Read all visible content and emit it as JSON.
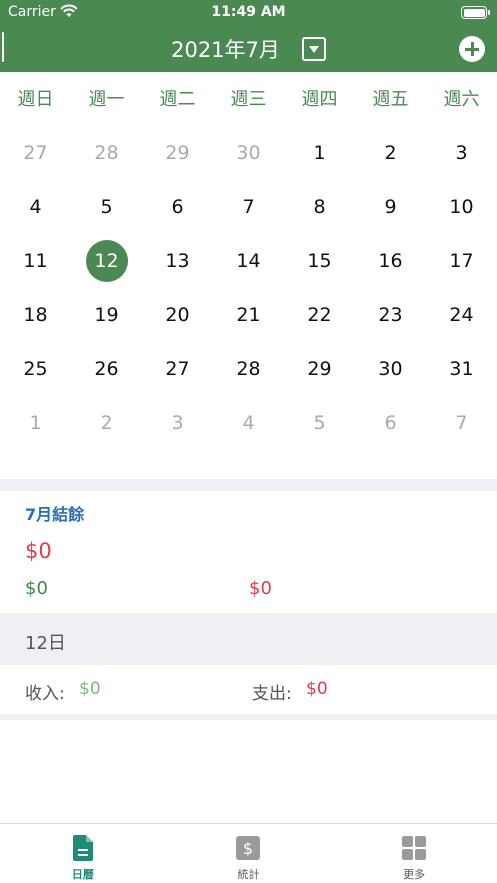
{
  "status_bar": {
    "carrier": "Carrier",
    "time": "11:49 AM"
  },
  "nav": {
    "title": "2021年7月"
  },
  "weekdays": [
    "週日",
    "週一",
    "週二",
    "週三",
    "週四",
    "週五",
    "週六"
  ],
  "calendar": {
    "days": [
      {
        "d": "27",
        "out": true
      },
      {
        "d": "28",
        "out": true
      },
      {
        "d": "29",
        "out": true
      },
      {
        "d": "30",
        "out": true
      },
      {
        "d": "1"
      },
      {
        "d": "2"
      },
      {
        "d": "3"
      },
      {
        "d": "4"
      },
      {
        "d": "5"
      },
      {
        "d": "6"
      },
      {
        "d": "7"
      },
      {
        "d": "8"
      },
      {
        "d": "9"
      },
      {
        "d": "10"
      },
      {
        "d": "11"
      },
      {
        "d": "12",
        "selected": true
      },
      {
        "d": "13"
      },
      {
        "d": "14"
      },
      {
        "d": "15"
      },
      {
        "d": "16"
      },
      {
        "d": "17"
      },
      {
        "d": "18"
      },
      {
        "d": "19"
      },
      {
        "d": "20"
      },
      {
        "d": "21"
      },
      {
        "d": "22"
      },
      {
        "d": "23"
      },
      {
        "d": "24"
      },
      {
        "d": "25"
      },
      {
        "d": "26"
      },
      {
        "d": "27"
      },
      {
        "d": "28"
      },
      {
        "d": "29"
      },
      {
        "d": "30"
      },
      {
        "d": "31"
      },
      {
        "d": "1",
        "out": true
      },
      {
        "d": "2",
        "out": true
      },
      {
        "d": "3",
        "out": true
      },
      {
        "d": "4",
        "out": true
      },
      {
        "d": "5",
        "out": true
      },
      {
        "d": "6",
        "out": true
      },
      {
        "d": "7",
        "out": true
      }
    ]
  },
  "summary": {
    "title": "7月結餘",
    "balance": "$0",
    "income": "$0",
    "expense": "$0"
  },
  "day_detail": {
    "label": "12日",
    "income_label": "收入:",
    "income_value": "$0",
    "expense_label": "支出:",
    "expense_value": "$0"
  },
  "tabs": [
    {
      "label": "日曆",
      "icon": "document-icon"
    },
    {
      "label": "統計",
      "icon": "dollar-icon"
    },
    {
      "label": "更多",
      "icon": "grid-icon"
    }
  ],
  "colors": {
    "primary": "#4a8a52",
    "expense": "#e03c4a",
    "income": "#3e8a45",
    "accent_blue": "#2a6db5",
    "tab_active": "#1f8a7a"
  }
}
